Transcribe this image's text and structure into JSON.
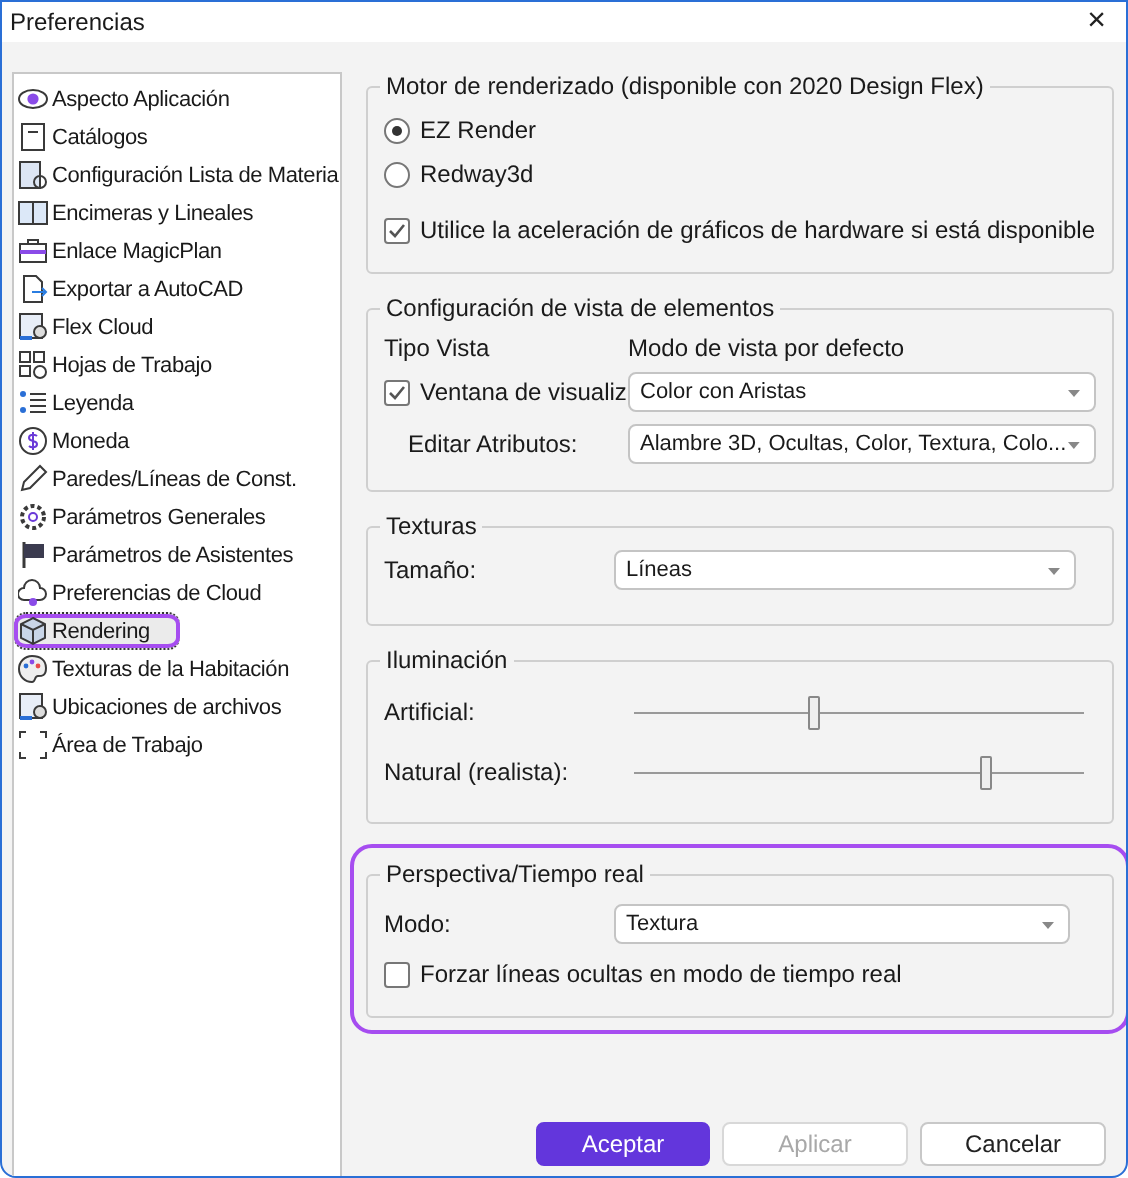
{
  "window": {
    "title": "Preferencias",
    "close": "×"
  },
  "sidebar": {
    "items": [
      {
        "label": "Aspecto Aplicación",
        "selected": false,
        "highlighted": false
      },
      {
        "label": "Catálogos",
        "selected": false,
        "highlighted": false
      },
      {
        "label": "Configuración Lista de Materia",
        "selected": false,
        "highlighted": false
      },
      {
        "label": "Encimeras y Lineales",
        "selected": false,
        "highlighted": false
      },
      {
        "label": "Enlace MagicPlan",
        "selected": false,
        "highlighted": false
      },
      {
        "label": "Exportar a AutoCAD",
        "selected": false,
        "highlighted": false
      },
      {
        "label": "Flex Cloud",
        "selected": false,
        "highlighted": false
      },
      {
        "label": "Hojas de Trabajo",
        "selected": false,
        "highlighted": false
      },
      {
        "label": "Leyenda",
        "selected": false,
        "highlighted": false
      },
      {
        "label": "Moneda",
        "selected": false,
        "highlighted": false
      },
      {
        "label": "Paredes/Líneas de Const.",
        "selected": false,
        "highlighted": false
      },
      {
        "label": "Parámetros Generales",
        "selected": false,
        "highlighted": false
      },
      {
        "label": "Parámetros de Asistentes",
        "selected": false,
        "highlighted": false
      },
      {
        "label": "Preferencias de Cloud",
        "selected": false,
        "highlighted": false
      },
      {
        "label": "Rendering",
        "selected": true,
        "highlighted": true
      },
      {
        "label": "Texturas de la Habitación",
        "selected": false,
        "highlighted": false
      },
      {
        "label": "Ubicaciones de archivos",
        "selected": false,
        "highlighted": false
      },
      {
        "label": "Área de Trabajo",
        "selected": false,
        "highlighted": false
      }
    ]
  },
  "render_engine": {
    "title": "Motor de renderizado (disponible con 2020 Design Flex)",
    "options": [
      {
        "label": "EZ Render",
        "selected": true
      },
      {
        "label": "Redway3d",
        "selected": false
      }
    ],
    "hardware_acceleration": {
      "label": "Utilice la aceleración de gráficos de hardware si está disponible",
      "checked": true
    }
  },
  "element_view": {
    "title": "Configuración de vista de elementos",
    "column_1": "Tipo Vista",
    "column_2": "Modo de vista por defecto",
    "rows": [
      {
        "kind": "checkbox",
        "label": "Ventana de visualiz",
        "checked": true,
        "value": "Color con Aristas"
      },
      {
        "kind": "label",
        "label": "Editar Atributos:",
        "value": "Alambre 3D, Ocultas, Color, Textura, Colo..."
      }
    ]
  },
  "textures": {
    "title": "Texturas",
    "label": "Tamaño:",
    "value": "Líneas"
  },
  "lighting": {
    "title": "Iluminación",
    "sliders": [
      {
        "label": "Artificial:",
        "level": 0.4
      },
      {
        "label": "Natural (realista):",
        "level": 0.78
      }
    ]
  },
  "realtime": {
    "title": "Perspectiva/Tiempo real",
    "highlighted": true,
    "label": "Modo:",
    "value": "Textura",
    "force_hidden_lines": {
      "label": "Forzar líneas ocultas en modo de tiempo real",
      "checked": false
    }
  },
  "buttons": [
    {
      "label": "Aceptar",
      "kind": "primary",
      "disabled": false
    },
    {
      "label": "Aplicar",
      "kind": "normal",
      "disabled": true
    },
    {
      "label": "Cancelar",
      "kind": "normal",
      "disabled": false
    }
  ]
}
